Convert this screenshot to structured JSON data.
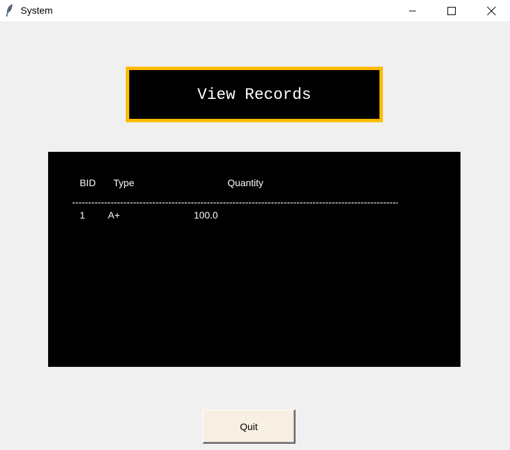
{
  "window": {
    "title": "System",
    "icon": "feather-icon",
    "controls": [
      "minimize-icon",
      "maximize-icon",
      "close-icon"
    ]
  },
  "heading": {
    "text": "View Records",
    "border_color": "#ffbb00",
    "background": "#000000"
  },
  "records": {
    "columns": [
      "BID",
      "Type",
      "Quantity"
    ],
    "divider": "------------------------------------------------------------------------------------------------------",
    "rows": [
      {
        "bid": "1",
        "type": "A+",
        "quantity": "100.0"
      }
    ]
  },
  "footer": {
    "quit_label": "Quit"
  }
}
